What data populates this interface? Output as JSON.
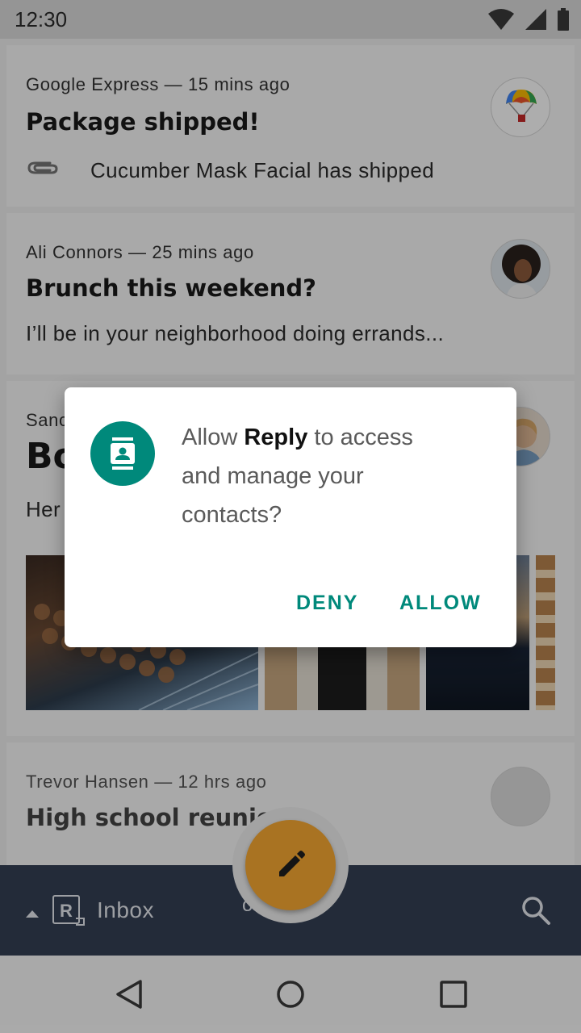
{
  "status_bar": {
    "time": "12:30"
  },
  "emails": [
    {
      "sender": "Google Express",
      "time_ago": "15 mins ago",
      "subject": "Package shipped!",
      "preview": "Cucumber Mask Facial has shipped",
      "has_attachment": true
    },
    {
      "sender": "Ali Connors",
      "time_ago": "25 mins ago",
      "subject": "Brunch this weekend?",
      "preview": "I’ll be in your neighborhood doing errands..."
    },
    {
      "sender_partial": "Sanc",
      "subject_partial": "Bo",
      "preview_partial": "Her"
    },
    {
      "sender": "Trevor Hansen",
      "time_ago": "12 hrs ago",
      "subject": "High school reunion?"
    }
  ],
  "bottom_bar": {
    "label": "Inbox",
    "hidden_label_fragment": "o"
  },
  "dialog": {
    "text_prefix": "Allow ",
    "app_name": "Reply",
    "text_line1_suffix": " to access",
    "text_line2": "and manage your",
    "text_line3": "contacts?",
    "deny_label": "DENY",
    "allow_label": "ALLOW",
    "icon": "contacts-icon"
  },
  "colors": {
    "accent": "#00897b",
    "fab": "#f9aa33",
    "appbar": "#344055"
  }
}
